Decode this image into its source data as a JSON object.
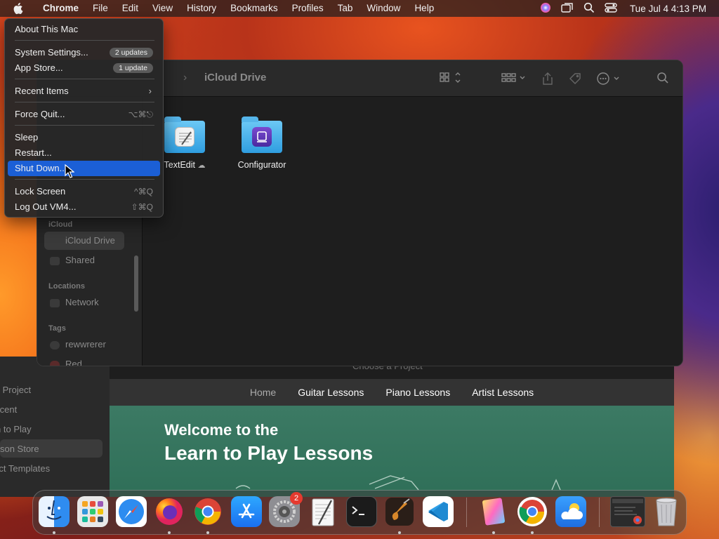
{
  "menubar": {
    "app": "Chrome",
    "items": [
      "File",
      "Edit",
      "View",
      "History",
      "Bookmarks",
      "Profiles",
      "Tab",
      "Window",
      "Help"
    ],
    "clock": "Tue Jul 4  4:13 PM"
  },
  "apple_menu": {
    "about": "About This Mac",
    "settings": "System Settings...",
    "settings_badge": "2 updates",
    "appstore": "App Store...",
    "appstore_badge": "1 update",
    "recent": "Recent Items",
    "forcequit": "Force Quit...",
    "forcequit_sc": "⌥⌘⎋",
    "sleep": "Sleep",
    "restart": "Restart...",
    "shutdown": "Shut Down...",
    "lock": "Lock Screen",
    "lock_sc": "^⌘Q",
    "logout": "Log Out VM4...",
    "logout_sc": "⇧⌘Q"
  },
  "finder": {
    "title": "iCloud Drive",
    "sidebar": {
      "icloud_head": "iCloud",
      "icloud_drive": "iCloud Drive",
      "shared": "Shared",
      "locations_head": "Locations",
      "network": "Network",
      "tags_head": "Tags",
      "tag1": "rewwrerer",
      "tag2": "Red"
    },
    "items": [
      {
        "label": "TextEdit"
      },
      {
        "label": "Configurator"
      }
    ]
  },
  "back_app": {
    "sidebar": [
      "New Project",
      "Recent",
      "Learn to Play",
      "Lesson Store",
      "Project Templates"
    ],
    "choose": "Choose a Project",
    "nav": [
      "Home",
      "Guitar Lessons",
      "Piano Lessons",
      "Artist Lessons"
    ],
    "hero_line1": "Welcome to the",
    "hero_line2": "Learn to Play Lessons"
  },
  "dock": {
    "settings_badge": "2"
  }
}
